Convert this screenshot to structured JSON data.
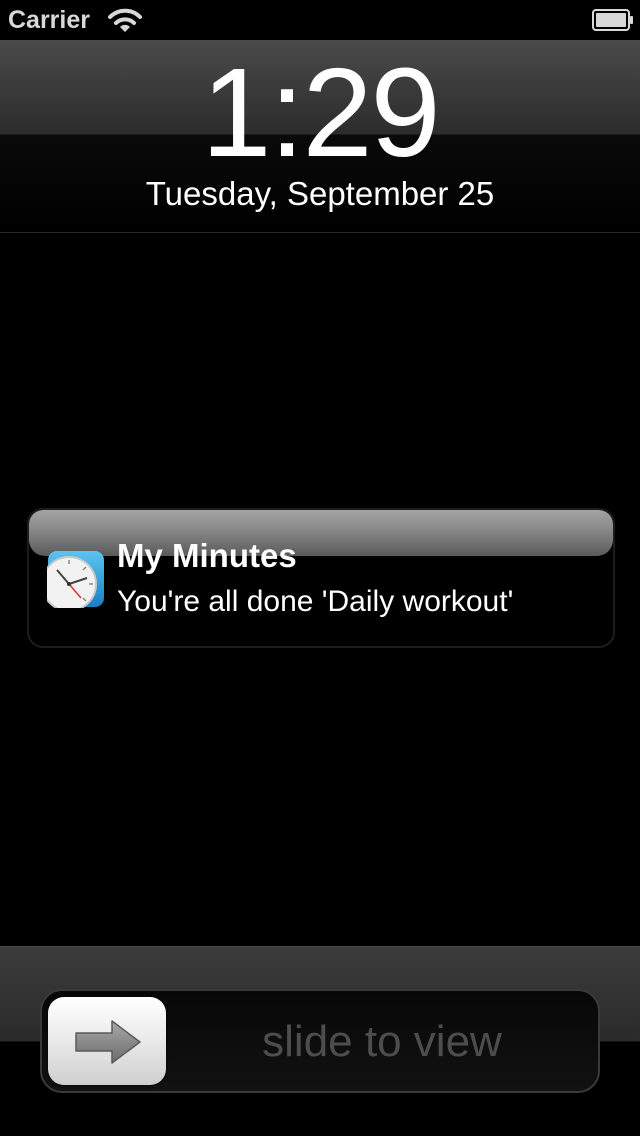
{
  "status_bar": {
    "carrier": "Carrier",
    "icons": [
      "wifi-icon",
      "battery-icon"
    ]
  },
  "lock_screen": {
    "time": "1:29",
    "date": "Tuesday, September 25"
  },
  "notification": {
    "app_icon": "clock-app-icon",
    "title": "My Minutes",
    "message": "You're all done 'Daily workout'"
  },
  "slider": {
    "label": "slide to view",
    "knob_icon": "arrow-right-icon"
  },
  "colors": {
    "background": "#000000",
    "text": "#ffffff",
    "slider_label": "#4d4d4d",
    "app_icon_blue": "#2a9ad8"
  }
}
